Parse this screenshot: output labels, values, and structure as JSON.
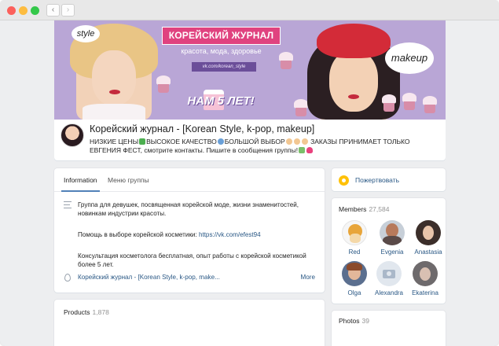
{
  "browser": {
    "back_glyph": "‹",
    "forward_glyph": "›"
  },
  "cover": {
    "banner_title": "КОРЕЙСКИЙ ЖУРНАЛ",
    "banner_subtitle": "красота, мода, здоровье",
    "banner_url": "vk.com/korean_style",
    "anniversary": "НАМ  5  ЛЕТ!",
    "bubble_left": "style",
    "bubble_right": "makeup"
  },
  "group": {
    "name": "Корейский журнал - [Korean Style, k-pop, makeup]",
    "status_part1": "НИЗКИЕ ЦЕНЫ",
    "status_part2": "ВЫСОКОЕ КАЧЕСТВО",
    "status_part3": "БОЛЬШОЙ ВЫБОР",
    "status_part4": " ЗАКАЗЫ ПРИНИМАЕТ ТОЛЬКО ЕВГЕНИЯ ФЕСТ, смотрите контакты. Пишите в сообщения группы!"
  },
  "info": {
    "tabs": [
      {
        "label": "Information"
      },
      {
        "label": "Меню группы"
      }
    ],
    "description_1": "Группа для девушек, посвященная корейской моде, жизни знаменитостей, новинкам индустрии красоты.",
    "description_2_prefix": "Помощь в выборе корейской косметики: ",
    "description_2_link": "https://vk.com/efest94",
    "description_3": "Консультация косметолога бесплатная, опыт работы с корейской косметикой более 5 лет.",
    "address": "Корейский журнал - [Korean Style, k-pop, make...",
    "more_label": "More"
  },
  "products": {
    "title": "Products",
    "count": "1,878"
  },
  "donate": {
    "label": "Пожертвовать"
  },
  "members": {
    "title": "Members",
    "count": "27,584",
    "list": [
      {
        "name": "Red"
      },
      {
        "name": "Evgenia"
      },
      {
        "name": "Anastasia"
      },
      {
        "name": "Olga"
      },
      {
        "name": "Alexandra"
      },
      {
        "name": "Ekaterina"
      }
    ]
  },
  "photos": {
    "title": "Photos",
    "count": "39"
  },
  "colors": {
    "link": "#2a5885",
    "accent_blue": "#5181b8",
    "page_bg": "#edeef0",
    "banner_pink": "#e0427f",
    "cover_purple": "#b9a6d6"
  }
}
